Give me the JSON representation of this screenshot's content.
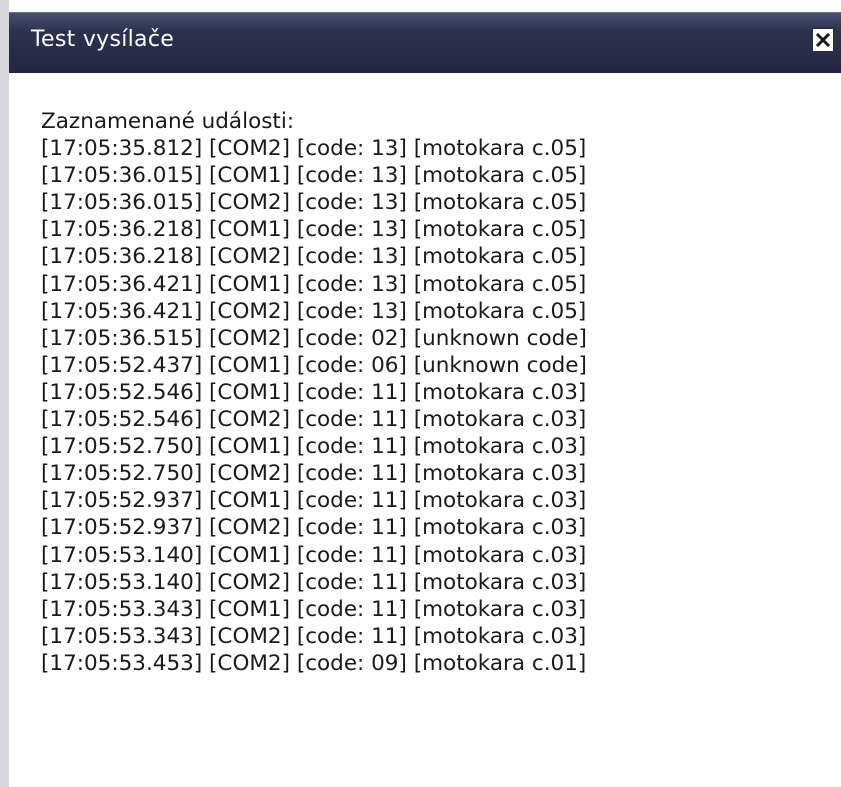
{
  "dialog": {
    "title": "Test vysílače",
    "close_icon": "close-icon"
  },
  "log": {
    "heading": "Zaznamenané události:",
    "entries": [
      "[17:05:35.812] [COM2] [code: 13] [motokara c.05]",
      "[17:05:36.015] [COM1] [code: 13] [motokara c.05]",
      "[17:05:36.015] [COM2] [code: 13] [motokara c.05]",
      "[17:05:36.218] [COM1] [code: 13] [motokara c.05]",
      "[17:05:36.218] [COM2] [code: 13] [motokara c.05]",
      "[17:05:36.421] [COM1] [code: 13] [motokara c.05]",
      "[17:05:36.421] [COM2] [code: 13] [motokara c.05]",
      "[17:05:36.515] [COM2] [code: 02] [unknown code]",
      "[17:05:52.437] [COM1] [code: 06] [unknown code]",
      "[17:05:52.546] [COM1] [code: 11] [motokara c.03]",
      "[17:05:52.546] [COM2] [code: 11] [motokara c.03]",
      "[17:05:52.750] [COM1] [code: 11] [motokara c.03]",
      "[17:05:52.750] [COM2] [code: 11] [motokara c.03]",
      "[17:05:52.937] [COM1] [code: 11] [motokara c.03]",
      "[17:05:52.937] [COM2] [code: 11] [motokara c.03]",
      "[17:05:53.140] [COM1] [code: 11] [motokara c.03]",
      "[17:05:53.140] [COM2] [code: 11] [motokara c.03]",
      "[17:05:53.343] [COM1] [code: 11] [motokara c.03]",
      "[17:05:53.343] [COM2] [code: 11] [motokara c.03]",
      "[17:05:53.453] [COM2] [code: 09] [motokara c.01]"
    ]
  },
  "colors": {
    "titlebar": "#2e3251",
    "title_text": "#ffffff",
    "body_text": "#1a1a1a"
  }
}
